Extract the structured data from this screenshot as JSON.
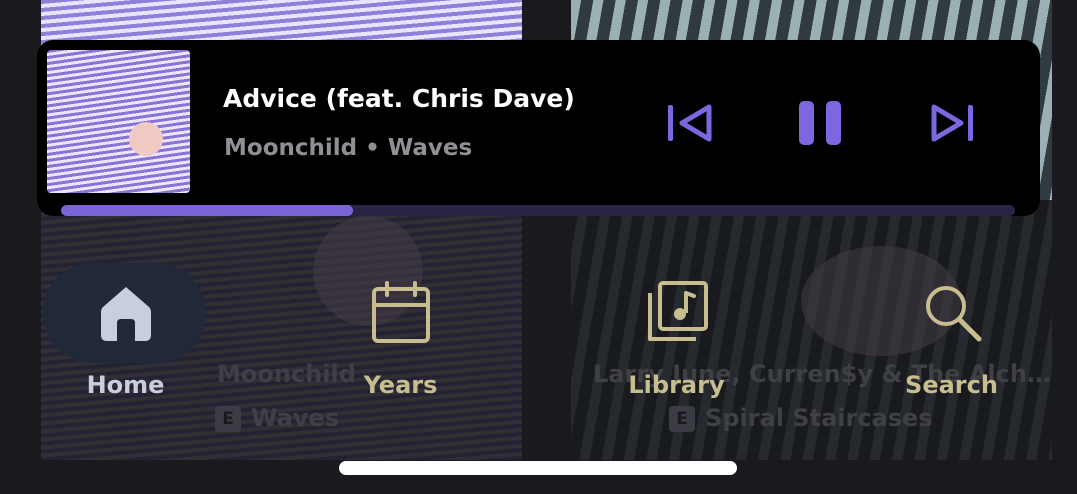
{
  "colors": {
    "accent": "#7c64d8",
    "tab_active": "#c9cedd",
    "tab_inactive": "#c8bd8f",
    "player_bg": "#000000"
  },
  "background_albums": [
    {
      "artist": "Moonchild",
      "explicit_badge": "E",
      "album": "Waves"
    },
    {
      "artist": "Larry June, Curren$y & The Alch…",
      "explicit_badge": "E",
      "album": "Spiral Staircases"
    }
  ],
  "now_playing": {
    "title": "Advice (feat. Chris Dave)",
    "subtitle": "Moonchild • Waves",
    "progress_fraction": 0.306,
    "controls": {
      "prev_icon": "skip-previous-icon",
      "pause_icon": "pause-icon",
      "next_icon": "skip-next-icon"
    }
  },
  "tabs": [
    {
      "label": "Home",
      "icon": "home-icon",
      "active": true
    },
    {
      "label": "Years",
      "icon": "calendar-icon",
      "active": false
    },
    {
      "label": "Library",
      "icon": "library-icon",
      "active": false
    },
    {
      "label": "Search",
      "icon": "search-icon",
      "active": false
    }
  ]
}
